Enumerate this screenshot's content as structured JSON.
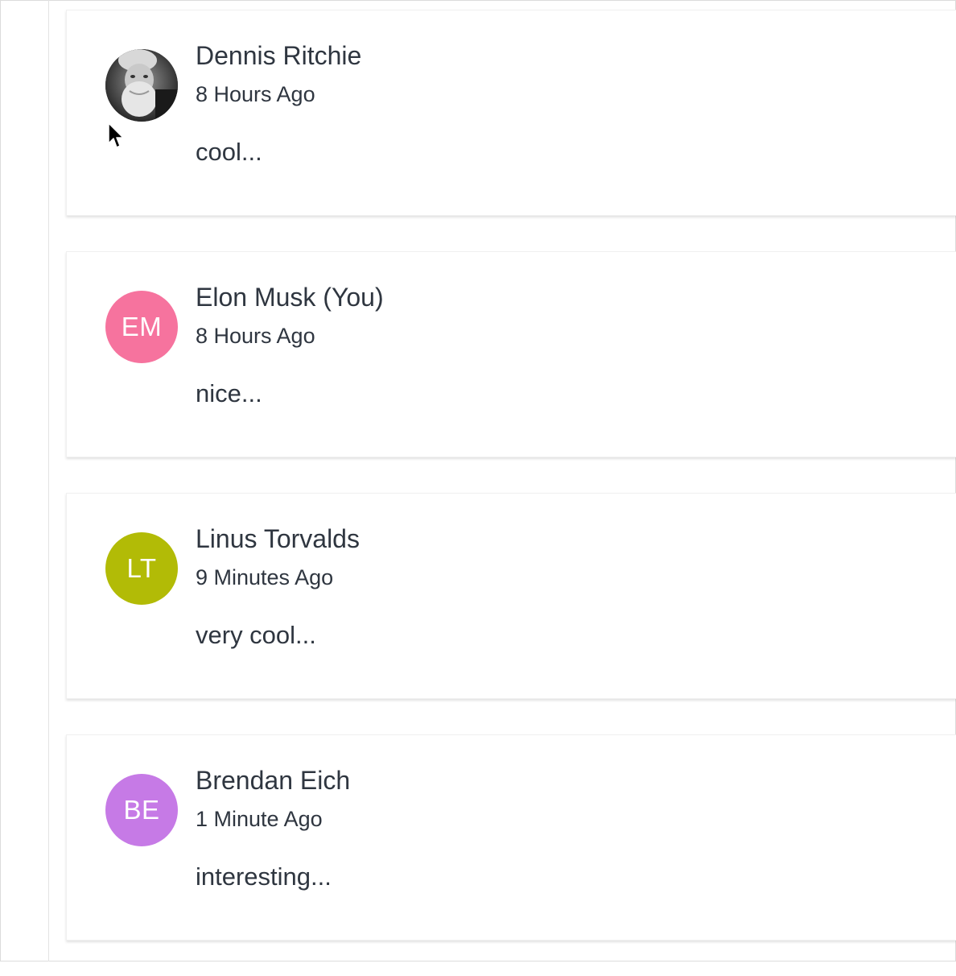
{
  "comments": [
    {
      "author": "Dennis Ritchie",
      "time": "8 Hours Ago",
      "text": "cool...",
      "avatar": {
        "type": "photo",
        "icon": "user-photo-icon"
      }
    },
    {
      "author": "Elon Musk (You)",
      "time": "8 Hours Ago",
      "text": "nice...",
      "avatar": {
        "type": "initials",
        "initials": "EM",
        "color": "#f6739e"
      }
    },
    {
      "author": "Linus Torvalds",
      "time": "9 Minutes Ago",
      "text": "very cool...",
      "avatar": {
        "type": "initials",
        "initials": "LT",
        "color": "#b2bb06"
      }
    },
    {
      "author": "Brendan Eich",
      "time": "1 Minute Ago",
      "text": "interesting...",
      "avatar": {
        "type": "initials",
        "initials": "BE",
        "color": "#c67ae6"
      }
    }
  ],
  "cursor": {
    "icon": "mouse-pointer-icon"
  }
}
